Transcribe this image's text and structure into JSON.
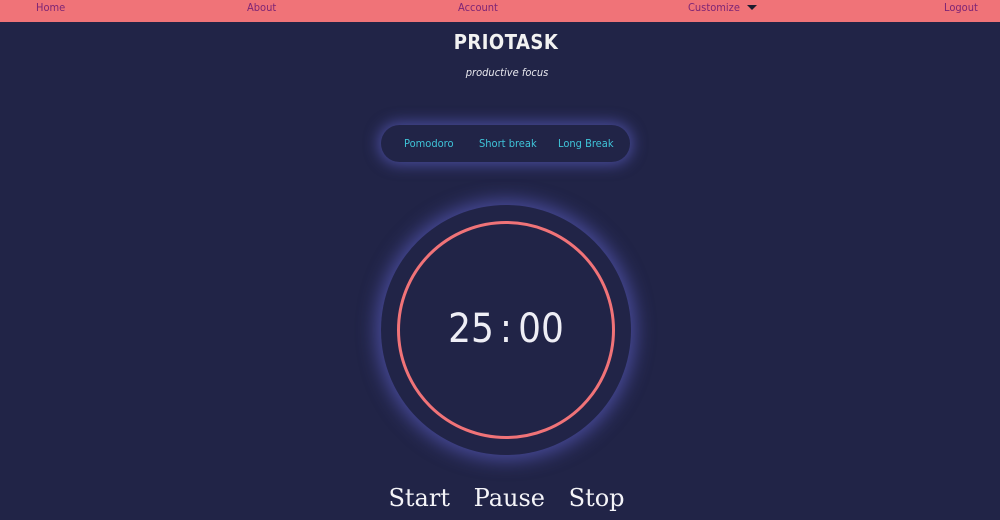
{
  "nav": {
    "home": "Home",
    "about": "About",
    "account": "Account",
    "customize": "Customize",
    "logout": "Logout"
  },
  "brand": {
    "title": "PRIOTASK",
    "tagline": "productive focus"
  },
  "modes": {
    "pomodoro": "Pomodoro",
    "short_break": "Short break",
    "long_break": "Long Break"
  },
  "timer": {
    "minutes": "25",
    "separator": ":",
    "seconds": "00"
  },
  "controls": {
    "start": "Start",
    "pause": "Pause",
    "stop": "Stop"
  },
  "colors": {
    "background": "#212447",
    "navbar": "#f07378",
    "nav_text": "#7d2475",
    "mode_text": "#3fc3d8",
    "ring": "#f07378",
    "glow": "#686adc"
  },
  "icons": {
    "customize_dropdown": "caret-down-icon"
  }
}
